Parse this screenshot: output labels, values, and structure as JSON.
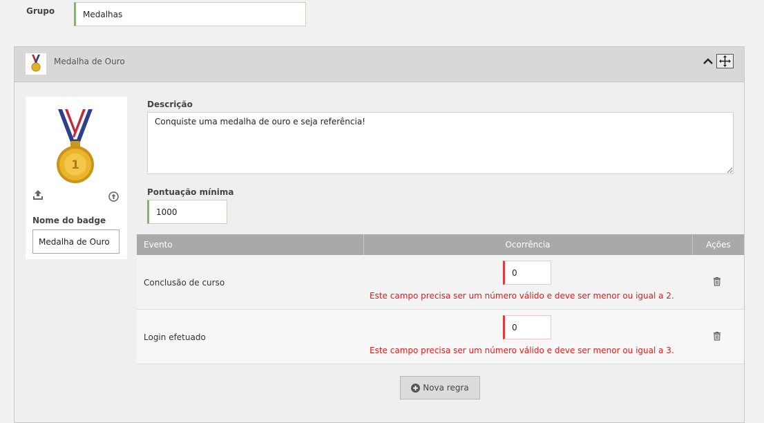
{
  "group": {
    "label": "Grupo",
    "value": "Medalhas"
  },
  "badge": {
    "title": "Medalha de Ouro",
    "name_label": "Nome do badge",
    "name_value": "Medalha de Ouro",
    "description_label": "Descrição",
    "description_value": "Conquiste uma medalha de ouro e seja referência!",
    "min_score_label": "Pontuação mínima",
    "min_score_value": "1000",
    "medal_number": "1"
  },
  "rules": {
    "headers": {
      "event": "Evento",
      "occurrence": "Ocorrência",
      "actions": "Ações"
    },
    "rows": [
      {
        "event": "Conclusão de curso",
        "occurrence": "0",
        "error": "Este campo precisa ser um número válido e deve ser menor ou igual a 2."
      },
      {
        "event": "Login efetuado",
        "occurrence": "0",
        "error": "Este campo precisa ser um número válido e deve ser menor ou igual a 3."
      }
    ],
    "new_rule_label": "Nova regra"
  },
  "colors": {
    "valid_accent": "#7cba5a",
    "error_accent": "#e03a3a",
    "error_text": "#e01b1b",
    "header_gray": "#a9a9a9"
  },
  "icons": [
    "medal-icon",
    "chevron-up-icon",
    "move-icon",
    "upload-icon",
    "arrow-up-circle-icon",
    "trash-icon",
    "plus-circle-icon"
  ]
}
